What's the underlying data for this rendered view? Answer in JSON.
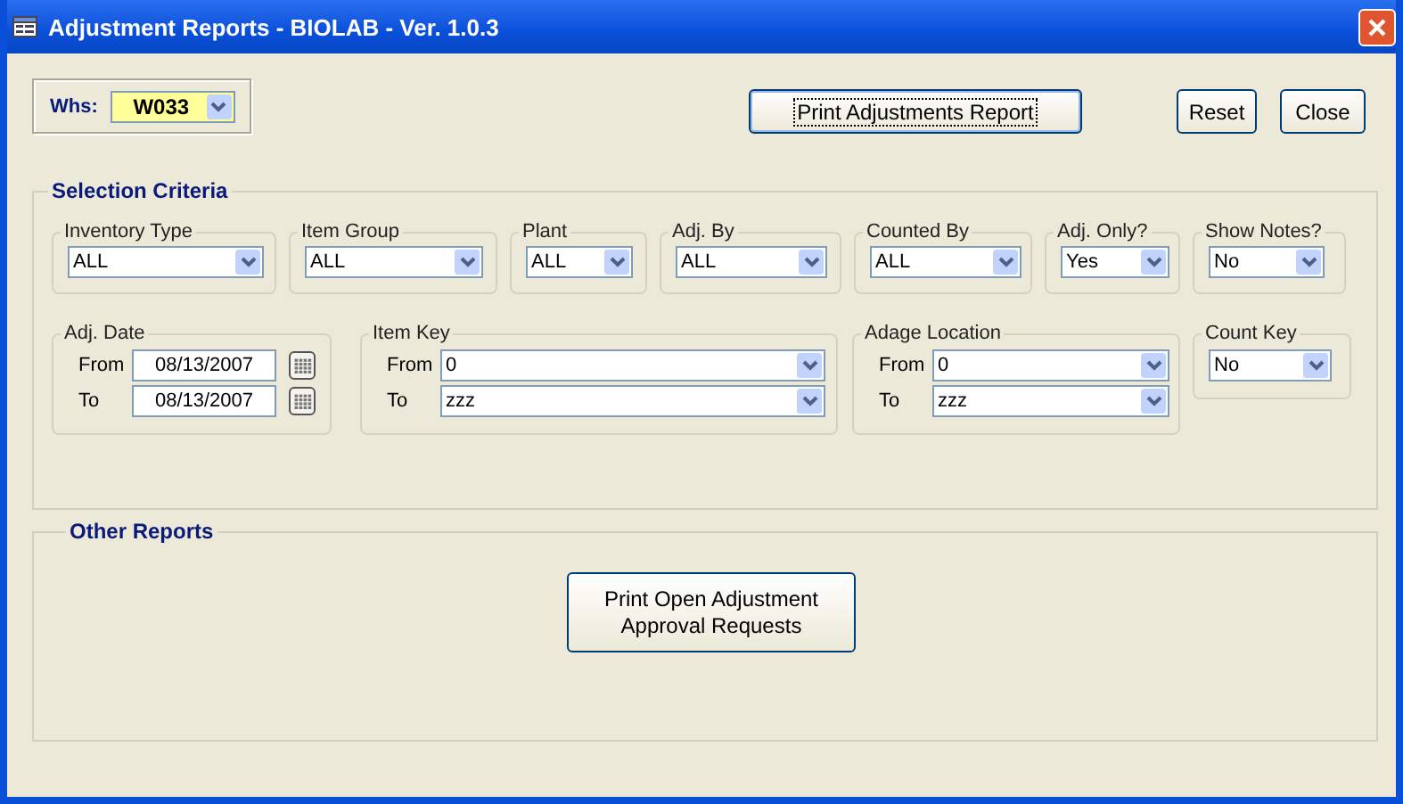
{
  "window": {
    "title": "Adjustment Reports -  BIOLAB - Ver. 1.0.3"
  },
  "whs": {
    "label": "Whs:",
    "value": "W033"
  },
  "top_buttons": [
    {
      "label": "Print Adjustments Report",
      "focused": true
    },
    {
      "label": "Reset",
      "focused": false
    },
    {
      "label": "Close",
      "focused": false
    }
  ],
  "selection_criteria": {
    "title": "Selection Criteria",
    "filters": [
      {
        "label": "Inventory Type",
        "value": "ALL"
      },
      {
        "label": "Item Group",
        "value": "ALL"
      },
      {
        "label": "Plant",
        "value": "ALL"
      },
      {
        "label": "Adj. By",
        "value": "ALL"
      },
      {
        "label": "Counted By",
        "value": "ALL"
      },
      {
        "label": "Adj. Only?",
        "value": "Yes"
      },
      {
        "label": "Show Notes?",
        "value": "No"
      }
    ],
    "ranges": [
      {
        "kind": "date",
        "label": "Adj. Date",
        "rows": [
          {
            "label": "From",
            "value": "08/13/2007"
          },
          {
            "label": "To",
            "value": "08/13/2007"
          }
        ]
      },
      {
        "kind": "combo",
        "label": "Item Key",
        "rows": [
          {
            "label": "From",
            "value": "0"
          },
          {
            "label": "To",
            "value": "zzz"
          }
        ]
      },
      {
        "kind": "combo",
        "label": "Adage Location",
        "rows": [
          {
            "label": "From",
            "value": "0"
          },
          {
            "label": "To",
            "value": "zzz"
          }
        ]
      },
      {
        "kind": "single",
        "label": "Count Key",
        "rows": [
          {
            "value": "No"
          }
        ]
      }
    ]
  },
  "other_reports": {
    "title": "Other Reports",
    "buttons": [
      "Print Open Adjustment\nApproval Requests"
    ]
  }
}
